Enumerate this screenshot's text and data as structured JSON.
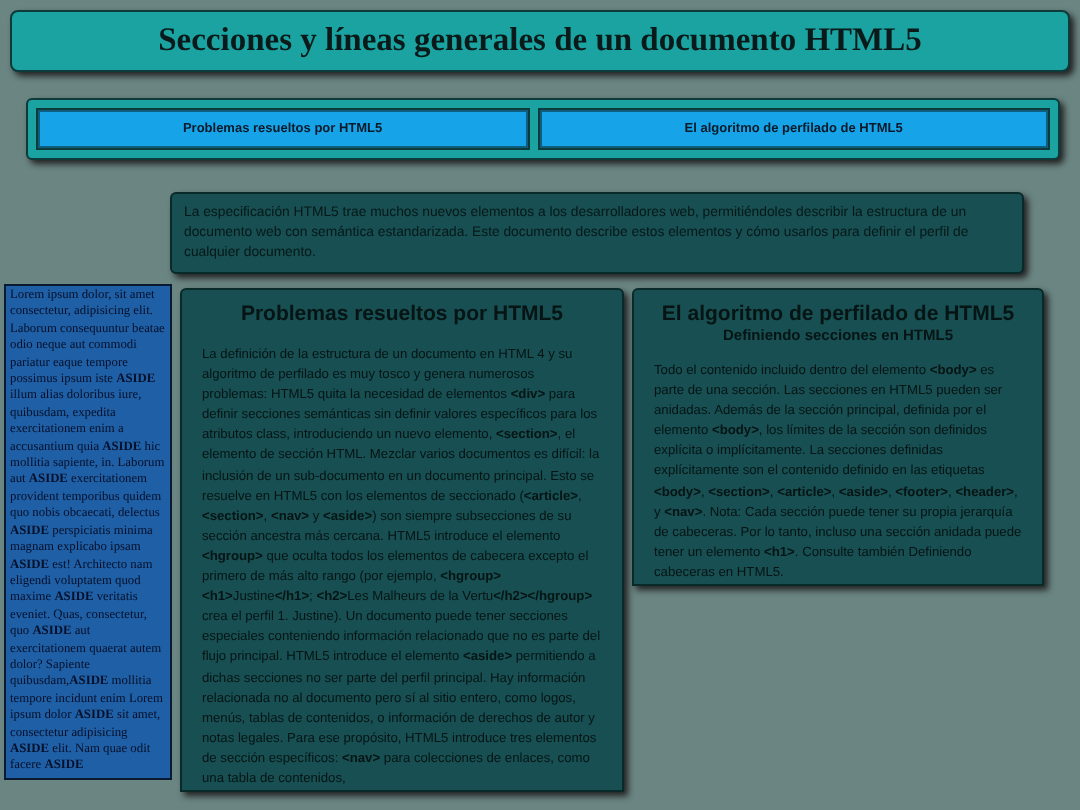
{
  "header": {
    "title": "Secciones y líneas generales de un documento HTML5"
  },
  "nav": {
    "links": [
      {
        "label": "Problemas resueltos por HTML5"
      },
      {
        "label": "El algoritmo de perfilado de HTML5"
      }
    ]
  },
  "intro": {
    "text": "La especificación HTML5 trae muchos nuevos elementos a los desarrolladores web, permitiéndoles describir la estructura de un documento web con semántica estandarizada. Este documento describe estos elementos y cómo usarlos para definir el perfil de cualquier documento."
  },
  "aside": {
    "text": "Lorem ipsum dolor, sit amet consectetur, adipisicing elit. Laborum consequuntur beatae odio neque aut commodi pariatur eaque tempore possimus ipsum iste **ASIDE** illum alias doloribus iure, quibusdam, expedita exercitationem enim a accusantium quia **ASIDE** hic mollitia sapiente, in. Laborum aut **ASIDE** exercitationem provident temporibus quidem quo nobis obcaecati, delectus **ASIDE** perspiciatis minima magnam explicabo ipsam **ASIDE** est! Architecto nam eligendi voluptatem quod maxime **ASIDE** veritatis eveniet. Quas, consectetur, quo **ASIDE** aut exercitationem quaerat autem dolor? Sapiente quibusdam,**ASIDE** mollitia tempore incidunt enim Lorem ipsum dolor **ASIDE** sit amet, consectetur adipisicing **ASIDE** elit. Nam quae odit facere **ASIDE**"
  },
  "articles": [
    {
      "title": "Problemas resueltos por HTML5",
      "text": "La definición de la estructura de un documento en HTML 4 y su algoritmo de perfilado es muy tosco y genera numerosos problemas: HTML5 quita la necesidad de elementos **<div>** para definir secciones semánticas sin definir valores específicos para los atributos class, introduciendo un nuevo elemento, **<section>**, el elemento de sección HTML. Mezclar varios documentos es difícil: la inclusión de un sub-documento en un documento principal. Esto se resuelve en HTML5 con los elementos de seccionado (**<article>**, **<section>**, **<nav>** y **<aside>**) son siempre subsecciones de su sección ancestra más cercana. HTML5 introduce el elemento **<hgroup>** que oculta todos los elementos de cabecera excepto el primero de más alto rango (por ejemplo, **<hgroup><h1>**Justine**</h1>**; **<h2>**Les Malheurs de la Vertu**</h2></hgroup>** crea el perfil 1. Justine). Un documento puede tener secciones especiales conteniendo información relacionado que no es parte del flujo principal. HTML5 introduce el elemento **<aside>** permitiendo a dichas secciones no ser parte del perfil principal. Hay información relacionada no al documento pero sí al sitio entero, como logos, menús, tablas de contenidos, o información de derechos de autor y notas legales. Para ese propósito, HTML5 introduce tres elementos de sección específicos: **<nav>** para colecciones de enlaces, como una tabla de contenidos,"
    },
    {
      "title": "El algoritmo de perfilado de HTML5",
      "subtitle": "Definiendo secciones en HTML5",
      "text": "Todo el contenido incluido dentro del elemento **<body>** es parte de una sección. Las secciones en HTML5 pueden ser anidadas. Además de la sección principal, definida por el elemento **<body>**, los límites de la sección son definidos explícita o implícitamente. La secciones definidas explícitamente son el contenido definido en las etiquetas **<body>**, **<section>**, **<article>**, **<aside>**, **<footer>**, **<header>**, y **<nav>**. Nota: Cada sección puede tener su propia jerarquía de cabeceras. Por lo tanto, incluso una sección anidada puede tener un elemento **<h1>**. Consulte también Definiendo cabeceras en HTML5."
    }
  ]
}
